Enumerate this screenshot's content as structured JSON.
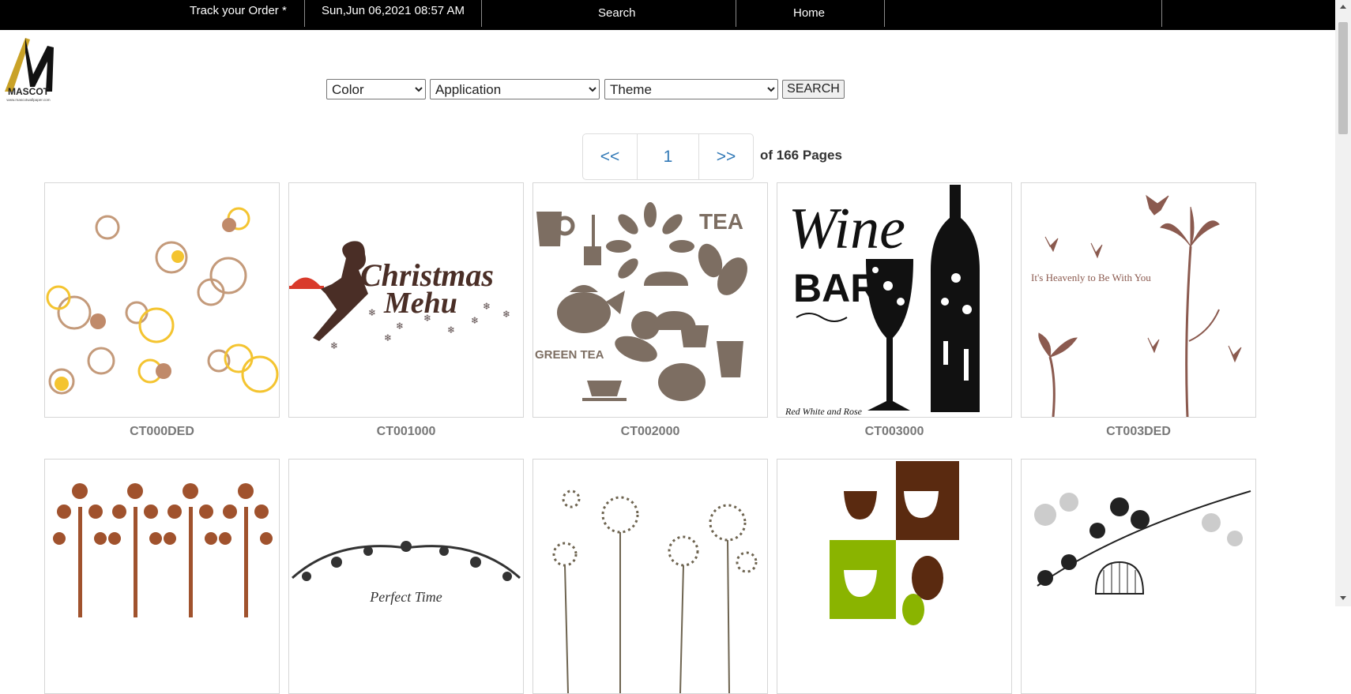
{
  "topbar": {
    "track_label": "Track your Order *",
    "datetime": "Sun,Jun 06,2021 08:57 AM",
    "search_label": "Search",
    "home_label": "Home"
  },
  "logo": {
    "text": "MASCOT",
    "subtext": "www.mascotwallpaper.com"
  },
  "filters": {
    "color_selected": "Color",
    "application_selected": "Application",
    "theme_selected": "Theme",
    "search_button": "SEARCH"
  },
  "pagination": {
    "prev": "<<",
    "current": "1",
    "next": ">>",
    "of_pages": "of 166 Pages"
  },
  "products": [
    {
      "code": "CT000DED"
    },
    {
      "code": "CT001000",
      "image_text": [
        "Christmas",
        "Mehu"
      ]
    },
    {
      "code": "CT002000",
      "image_text": [
        "TEA",
        "GREEN TEA"
      ]
    },
    {
      "code": "CT003000",
      "image_text": [
        "Wine",
        "BAR",
        "Red White and Rose"
      ]
    },
    {
      "code": "CT003DED",
      "image_text": [
        "It's Heavenly to Be With You"
      ]
    },
    {
      "code": ""
    },
    {
      "code": "",
      "image_text": [
        "Perfect Time"
      ]
    },
    {
      "code": ""
    },
    {
      "code": ""
    },
    {
      "code": ""
    }
  ],
  "colors": {
    "topbar_bg": "#000000",
    "link_blue": "#337ab7",
    "label_gray": "#777777",
    "brown": "#5b3a2e",
    "tea_taupe": "#7d6e62",
    "bird_rose": "#8b5a4f",
    "bubble_tan": "#c49a7a",
    "bubble_yellow": "#f4c430",
    "coffee_brown": "#5a2a10",
    "coffee_green": "#8ab400",
    "tree_rust": "#a0522d"
  }
}
